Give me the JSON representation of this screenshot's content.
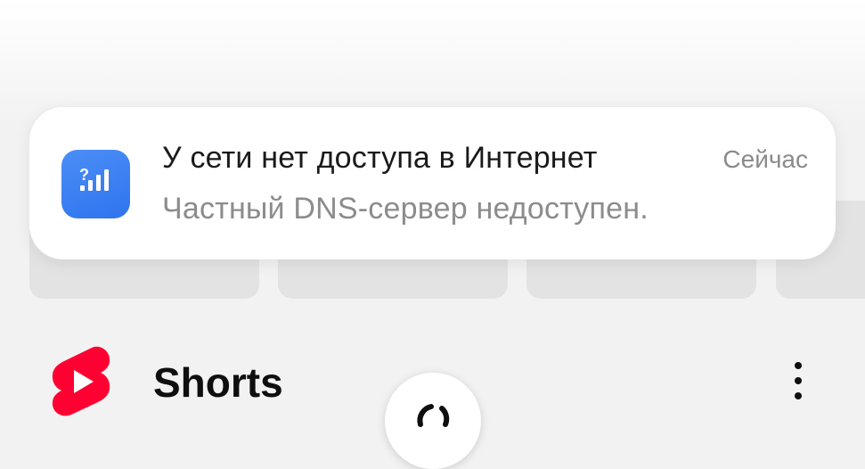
{
  "notification": {
    "app_icon": "signal-question-icon",
    "title": "У сети нет доступа в Интернет",
    "time": "Сейчас",
    "body": "Частный DNS-сервер недоступен.",
    "icon_color": "#3a7ff2"
  },
  "shorts": {
    "logo_icon": "youtube-shorts-icon",
    "title": "Shorts",
    "more_icon": "more-vertical-icon",
    "brand_color": "#ff0033"
  },
  "loading": {
    "icon": "loading-spinner-icon"
  }
}
